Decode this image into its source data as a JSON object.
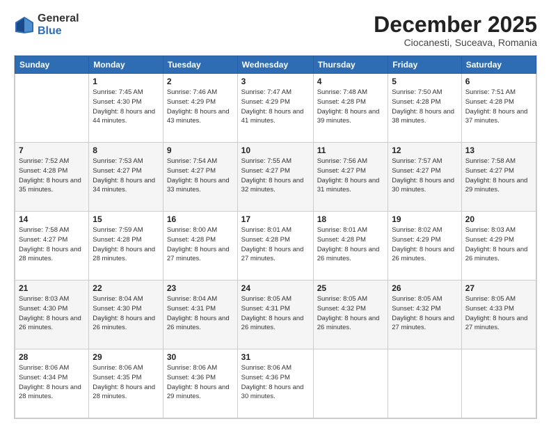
{
  "header": {
    "logo": {
      "line1": "General",
      "line2": "Blue"
    },
    "title": "December 2025",
    "location": "Ciocanesti, Suceava, Romania"
  },
  "days_of_week": [
    "Sunday",
    "Monday",
    "Tuesday",
    "Wednesday",
    "Thursday",
    "Friday",
    "Saturday"
  ],
  "weeks": [
    [
      {
        "day": "",
        "info": ""
      },
      {
        "day": "1",
        "info": "Sunrise: 7:45 AM\nSunset: 4:30 PM\nDaylight: 8 hours\nand 44 minutes."
      },
      {
        "day": "2",
        "info": "Sunrise: 7:46 AM\nSunset: 4:29 PM\nDaylight: 8 hours\nand 43 minutes."
      },
      {
        "day": "3",
        "info": "Sunrise: 7:47 AM\nSunset: 4:29 PM\nDaylight: 8 hours\nand 41 minutes."
      },
      {
        "day": "4",
        "info": "Sunrise: 7:48 AM\nSunset: 4:28 PM\nDaylight: 8 hours\nand 39 minutes."
      },
      {
        "day": "5",
        "info": "Sunrise: 7:50 AM\nSunset: 4:28 PM\nDaylight: 8 hours\nand 38 minutes."
      },
      {
        "day": "6",
        "info": "Sunrise: 7:51 AM\nSunset: 4:28 PM\nDaylight: 8 hours\nand 37 minutes."
      }
    ],
    [
      {
        "day": "7",
        "info": "Sunrise: 7:52 AM\nSunset: 4:28 PM\nDaylight: 8 hours\nand 35 minutes."
      },
      {
        "day": "8",
        "info": "Sunrise: 7:53 AM\nSunset: 4:27 PM\nDaylight: 8 hours\nand 34 minutes."
      },
      {
        "day": "9",
        "info": "Sunrise: 7:54 AM\nSunset: 4:27 PM\nDaylight: 8 hours\nand 33 minutes."
      },
      {
        "day": "10",
        "info": "Sunrise: 7:55 AM\nSunset: 4:27 PM\nDaylight: 8 hours\nand 32 minutes."
      },
      {
        "day": "11",
        "info": "Sunrise: 7:56 AM\nSunset: 4:27 PM\nDaylight: 8 hours\nand 31 minutes."
      },
      {
        "day": "12",
        "info": "Sunrise: 7:57 AM\nSunset: 4:27 PM\nDaylight: 8 hours\nand 30 minutes."
      },
      {
        "day": "13",
        "info": "Sunrise: 7:58 AM\nSunset: 4:27 PM\nDaylight: 8 hours\nand 29 minutes."
      }
    ],
    [
      {
        "day": "14",
        "info": "Sunrise: 7:58 AM\nSunset: 4:27 PM\nDaylight: 8 hours\nand 28 minutes."
      },
      {
        "day": "15",
        "info": "Sunrise: 7:59 AM\nSunset: 4:28 PM\nDaylight: 8 hours\nand 28 minutes."
      },
      {
        "day": "16",
        "info": "Sunrise: 8:00 AM\nSunset: 4:28 PM\nDaylight: 8 hours\nand 27 minutes."
      },
      {
        "day": "17",
        "info": "Sunrise: 8:01 AM\nSunset: 4:28 PM\nDaylight: 8 hours\nand 27 minutes."
      },
      {
        "day": "18",
        "info": "Sunrise: 8:01 AM\nSunset: 4:28 PM\nDaylight: 8 hours\nand 26 minutes."
      },
      {
        "day": "19",
        "info": "Sunrise: 8:02 AM\nSunset: 4:29 PM\nDaylight: 8 hours\nand 26 minutes."
      },
      {
        "day": "20",
        "info": "Sunrise: 8:03 AM\nSunset: 4:29 PM\nDaylight: 8 hours\nand 26 minutes."
      }
    ],
    [
      {
        "day": "21",
        "info": "Sunrise: 8:03 AM\nSunset: 4:30 PM\nDaylight: 8 hours\nand 26 minutes."
      },
      {
        "day": "22",
        "info": "Sunrise: 8:04 AM\nSunset: 4:30 PM\nDaylight: 8 hours\nand 26 minutes."
      },
      {
        "day": "23",
        "info": "Sunrise: 8:04 AM\nSunset: 4:31 PM\nDaylight: 8 hours\nand 26 minutes."
      },
      {
        "day": "24",
        "info": "Sunrise: 8:05 AM\nSunset: 4:31 PM\nDaylight: 8 hours\nand 26 minutes."
      },
      {
        "day": "25",
        "info": "Sunrise: 8:05 AM\nSunset: 4:32 PM\nDaylight: 8 hours\nand 26 minutes."
      },
      {
        "day": "26",
        "info": "Sunrise: 8:05 AM\nSunset: 4:32 PM\nDaylight: 8 hours\nand 27 minutes."
      },
      {
        "day": "27",
        "info": "Sunrise: 8:05 AM\nSunset: 4:33 PM\nDaylight: 8 hours\nand 27 minutes."
      }
    ],
    [
      {
        "day": "28",
        "info": "Sunrise: 8:06 AM\nSunset: 4:34 PM\nDaylight: 8 hours\nand 28 minutes."
      },
      {
        "day": "29",
        "info": "Sunrise: 8:06 AM\nSunset: 4:35 PM\nDaylight: 8 hours\nand 28 minutes."
      },
      {
        "day": "30",
        "info": "Sunrise: 8:06 AM\nSunset: 4:36 PM\nDaylight: 8 hours\nand 29 minutes."
      },
      {
        "day": "31",
        "info": "Sunrise: 8:06 AM\nSunset: 4:36 PM\nDaylight: 8 hours\nand 30 minutes."
      },
      {
        "day": "",
        "info": ""
      },
      {
        "day": "",
        "info": ""
      },
      {
        "day": "",
        "info": ""
      }
    ]
  ]
}
